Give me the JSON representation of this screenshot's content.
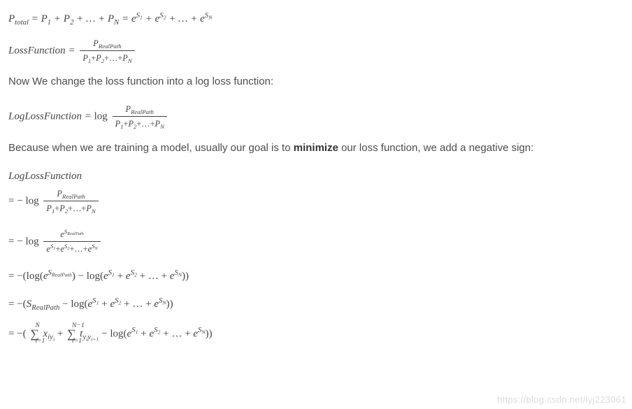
{
  "equations": {
    "ptotal_lhs": "P",
    "ptotal_sub": "total",
    "p": "P",
    "eq": " = ",
    "plus": " + ",
    "dots": " … ",
    "e": "e",
    "s": "S",
    "n1": "1",
    "n2": "2",
    "N": "N",
    "lossfn": "LossFunction",
    "realpath": "RealPath",
    "loglossfn": "LogLossFunction",
    "log": "log",
    "minus": "− ",
    "open": "(",
    "close": ")",
    "x": "x",
    "t": "t",
    "y": "y",
    "Srp": "S",
    "i": "i",
    "ip1": "i+1",
    "i_eq_1": "i=1",
    "Nminus1": "N−1"
  },
  "text": {
    "para1": "Now We change the loss function into a log loss function:",
    "para2a": "Because when we are training a model, usually our goal is to ",
    "para2b": "minimize",
    "para2c": " our loss function, we add a negative sign:"
  },
  "watermark": "https://blog.csdn.net/lyj223061"
}
